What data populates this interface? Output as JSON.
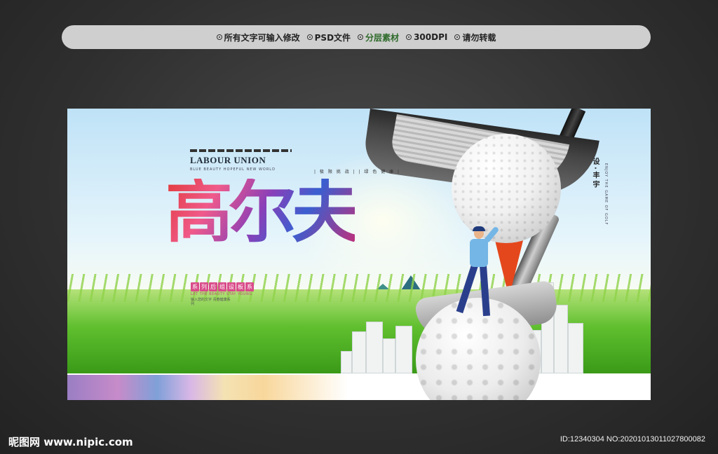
{
  "topbar": {
    "items": [
      {
        "label": "所有文字可输入修改"
      },
      {
        "label": "PSD文件"
      },
      {
        "label": "分层素材"
      },
      {
        "label": "300DPI"
      },
      {
        "label": "请勿转载"
      }
    ]
  },
  "poster": {
    "brand_small": "LABOUR UNION",
    "tiny_line": "BLUE BEAUTY HOPEFUL NEW WORLD",
    "tiny_tags": "| 极 限 挑 战 |  | 绿 色 健 康 |",
    "title": "高尔夫",
    "subtitle_chars": [
      "系",
      "列",
      "后",
      "组",
      "设",
      "板",
      "系"
    ],
    "subtitle_english": "LET THE BEAUTY STAY YOUNG",
    "subtitle_tiny": "输入您的文字 青春健康系列",
    "vertical_text": "设·丰宇",
    "vertical_thin": "ENJOY THE GAME OF GOLF"
  },
  "footer": {
    "site": "昵图网 www.nipic.com",
    "id_text": "ID:12340304 NO:20201013011027800082"
  },
  "colors": {
    "accent_green": "#2e6a2a",
    "title_gradient": [
      "#e23a3a",
      "#8a3fb8",
      "#3a5fd0"
    ]
  }
}
